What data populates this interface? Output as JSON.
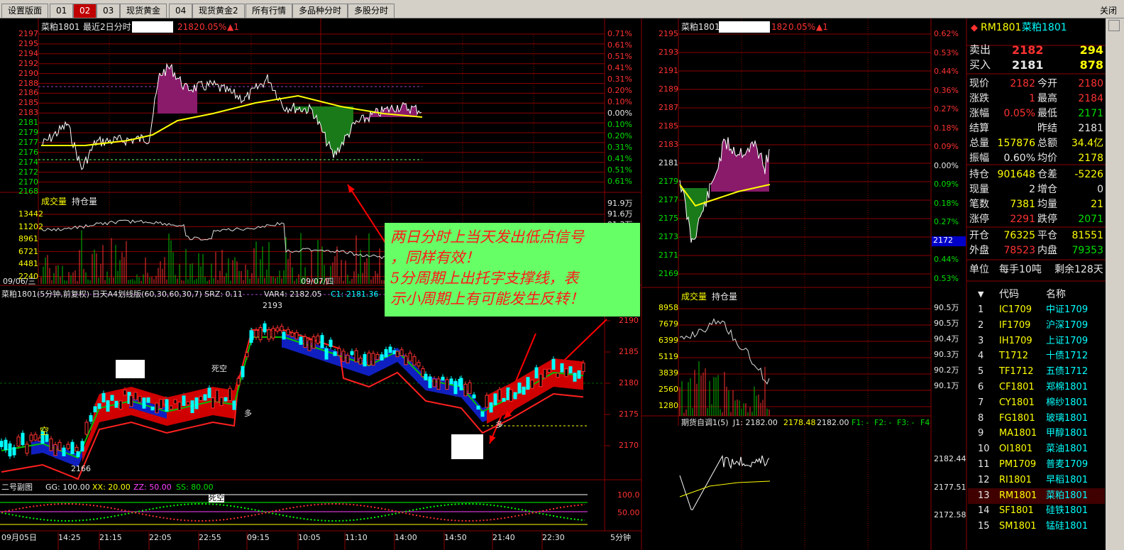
{
  "tabs": [
    "设置版面",
    "01",
    "02",
    "03",
    "现货黄金",
    "04",
    "现货黄金2",
    "所有行情",
    "多品种分时",
    "多股分时"
  ],
  "active_tab": "02",
  "close_label": "关闭",
  "twoday": {
    "symbol": "菜粕1801",
    "title": "最近2日分时",
    "price": "2182",
    "pct": "0.05%",
    "arrow": "▲1",
    "y_left": [
      "2197",
      "2195",
      "2194",
      "2192",
      "2190",
      "2188",
      "2186",
      "2185",
      "2183",
      "2181",
      "2179",
      "2177",
      "2176",
      "2174",
      "2172",
      "2170",
      "2168"
    ],
    "y_right": [
      "0.71%",
      "0.61%",
      "0.51%",
      "0.41%",
      "0.31%",
      "0.20%",
      "0.10%",
      "0.00%",
      "0.10%",
      "0.20%",
      "0.31%",
      "0.41%",
      "0.51%",
      "0.61%"
    ],
    "vol_label": "成交量",
    "oi_label": "持仓量",
    "vol_left": [
      "13442",
      "11202",
      "8961",
      "6721",
      "4481",
      "2240"
    ],
    "vol_right": [
      "91.9万",
      "91.6万",
      "91.3万",
      "91.0万"
    ],
    "dates": [
      "09/06/三",
      "09/07/四"
    ]
  },
  "k5": {
    "header": "菜粕1801(5分钟,前复权) 日天A4划线版(60,30,60,30,7)  SRZ: 0.11",
    "var4": "VAR4: 2182.05",
    "c1": "C1: 2181.36",
    "y_right": [
      "2190",
      "2185",
      "2180",
      "2175",
      "2170"
    ],
    "high": "2193",
    "low": "2166",
    "marks": {
      "kong": "空",
      "sikong": "死空",
      "duo1": "多",
      "duo2": "多"
    }
  },
  "sub": {
    "name": "二号副图",
    "gg": "GG: 100.00",
    "xx": "XX: 20.00",
    "zz": "ZZ: 50.00",
    "ss": "SS: 80.00",
    "levels": [
      "100.0",
      "50.00"
    ],
    "sikong": "死空",
    "times": [
      "09月05日",
      "14:25",
      "21:15",
      "22:05",
      "22:55",
      "09:15",
      "10:05",
      "11:10",
      "14:00",
      "14:50",
      "21:40",
      "22:30"
    ],
    "period": "5分钟"
  },
  "today": {
    "symbol": "菜粕1801",
    "price": "182",
    "pct": "0.05%",
    "arrow": "▲1",
    "y_left": [
      "2195",
      "2193",
      "2191",
      "2189",
      "2187",
      "2185",
      "2183",
      "2181",
      "2179",
      "2177",
      "2175",
      "2173",
      "2171",
      "2169"
    ],
    "y_right": [
      "0.62%",
      "0.53%",
      "0.44%",
      "0.36%",
      "0.27%",
      "0.18%",
      "0.09%",
      "0.00%",
      "0.09%",
      "0.18%",
      "0.27%",
      "0.36%",
      "0.44%",
      "0.53%"
    ],
    "cursor_price": "2172",
    "vol_label": "成交量",
    "oi_label": "持仓量",
    "vol_left": [
      "8958",
      "7679",
      "6399",
      "5119",
      "3839",
      "2560",
      "1280"
    ],
    "vol_right": [
      "90.5万",
      "90.5万",
      "90.4万",
      "90.3万",
      "90.2万",
      "90.1万"
    ]
  },
  "qihuo": {
    "name": "期货自调1(5)",
    "j1": "J1: 2182.00",
    "v2": "2178.48",
    "v3": "2182.00",
    "f1": "F1: -",
    "f2": "F2: -",
    "f3": "F3: -",
    "f4": "F4",
    "y": [
      "2182.44",
      "2177.51",
      "2172.58"
    ]
  },
  "quote": {
    "code": "RM1801",
    "name": "菜粕1801",
    "sell": {
      "label": "卖出",
      "price": "2182",
      "vol": "294"
    },
    "buy": {
      "label": "买入",
      "price": "2181",
      "vol": "878"
    },
    "rows": [
      [
        "现价",
        "2182",
        "今开",
        "2180"
      ],
      [
        "涨跌",
        "1",
        "最高",
        "2184"
      ],
      [
        "涨幅",
        "0.05%",
        "最低",
        "2171"
      ],
      [
        "结算",
        "",
        "昨结",
        "2181"
      ],
      [
        "总量",
        "157876",
        "总额",
        "34.4亿"
      ],
      [
        "振幅",
        "0.60%",
        "均价",
        "2178"
      ],
      [
        "持仓",
        "901648",
        "仓差",
        "-5226"
      ],
      [
        "现量",
        "2",
        "增仓",
        "0"
      ],
      [
        "笔数",
        "7381",
        "均量",
        "21"
      ],
      [
        "涨停",
        "2291",
        "跌停",
        "2071"
      ],
      [
        "开仓",
        "76325",
        "平仓",
        "81551"
      ],
      [
        "外盘",
        "78523",
        "内盘",
        "79353"
      ]
    ],
    "unit": "单位",
    "unit_val": "每手10吨",
    "remain": "剩余128天"
  },
  "list": {
    "h_code": "代码",
    "h_name": "名称",
    "items": [
      [
        "1",
        "IC1709",
        "中证1709"
      ],
      [
        "2",
        "IF1709",
        "沪深1709"
      ],
      [
        "3",
        "IH1709",
        "上证1709"
      ],
      [
        "4",
        "T1712",
        "十债1712"
      ],
      [
        "5",
        "TF1712",
        "五债1712"
      ],
      [
        "6",
        "CF1801",
        "郑棉1801"
      ],
      [
        "7",
        "CY1801",
        "棉纱1801"
      ],
      [
        "8",
        "FG1801",
        "玻璃1801"
      ],
      [
        "9",
        "MA1801",
        "甲醇1801"
      ],
      [
        "10",
        "OI1801",
        "菜油1801"
      ],
      [
        "11",
        "PM1709",
        "普麦1709"
      ],
      [
        "12",
        "RI1801",
        "早稻1801"
      ],
      [
        "13",
        "RM1801",
        "菜粕1801"
      ],
      [
        "14",
        "SF1801",
        "硅铁1801"
      ],
      [
        "15",
        "SM1801",
        "锰硅1801"
      ]
    ]
  },
  "annotation": [
    "两日分时上当天发出低点信号",
    "，同样有效！",
    "5分周期上出托字支撑线，表",
    "示小周期上有可能发生反转！"
  ],
  "colors": {
    "grid": "#8b0000",
    "up": "#ff3232",
    "down": "#00e000",
    "accent": "#66ff66"
  }
}
